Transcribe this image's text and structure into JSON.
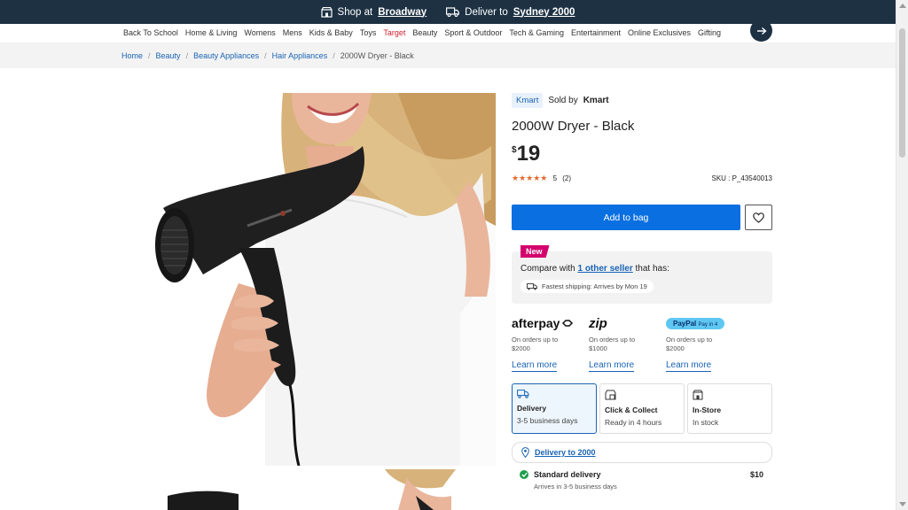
{
  "topbar": {
    "shop_prefix": "Shop at",
    "shop_store": "Broadway",
    "deliver_prefix": "Deliver to",
    "deliver_location": "Sydney 2000"
  },
  "nav": {
    "items": [
      "Back To School",
      "Home & Living",
      "Womens",
      "Mens",
      "Kids & Baby",
      "Toys",
      "Target",
      "Beauty",
      "Sport & Outdoor",
      "Tech & Gaming",
      "Entertainment",
      "Online Exclusives",
      "Gifting"
    ],
    "highlight_color": "#cc1f2f"
  },
  "breadcrumb": {
    "items": [
      "Home",
      "Beauty",
      "Beauty Appliances",
      "Hair Appliances"
    ],
    "current": "2000W Dryer - Black"
  },
  "product": {
    "brand_badge": "Kmart",
    "sold_by_prefix": "Sold by",
    "sold_by": "Kmart",
    "title": "2000W Dryer - Black",
    "price_currency": "$",
    "price": "19",
    "rating_stars": "★★★★★",
    "rating": "5",
    "review_count": "(2)",
    "sku": "SKU : P_43540013",
    "add_to_bag": "Add to bag"
  },
  "compare": {
    "badge": "New",
    "prefix": "Compare with",
    "link": "1 other seller",
    "suffix": "that has:",
    "shipping": "Fastest shipping: Arrives by Mon 19"
  },
  "payments": [
    {
      "logo": "afterpay",
      "line1": "On orders up to",
      "line2": "$2000",
      "learn": "Learn more"
    },
    {
      "logo": "zip",
      "line1": "On orders up to",
      "line2": "$1000",
      "learn": "Learn more"
    },
    {
      "logo": "PayPal",
      "logo_sub": "Pay in 4",
      "line1": "On orders up to",
      "line2": "$2000",
      "learn": "Learn more"
    }
  ],
  "delivery_options": [
    {
      "title": "Delivery",
      "sub": "3-5 business days",
      "icon": "truck-icon"
    },
    {
      "title": "Click & Collect",
      "sub": "Ready in 4 hours",
      "icon": "store-pickup-icon"
    },
    {
      "title": "In-Store",
      "sub": "In stock",
      "icon": "store-icon"
    }
  ],
  "destination": {
    "link": "Delivery to 2000"
  },
  "standard": {
    "label": "Standard delivery",
    "price": "$10",
    "sub": "Arrives in 3-5 business days"
  },
  "colors": {
    "brand_blue": "#0a6fe0",
    "top_bar": "#1d3143",
    "star": "#e36a2e",
    "new_badge": "#d4006c"
  }
}
